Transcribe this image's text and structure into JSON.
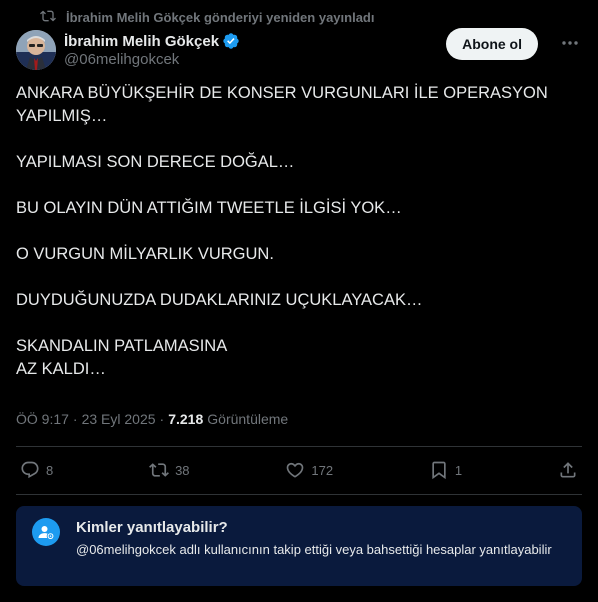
{
  "repost": {
    "icon": "repost-icon",
    "text": "İbrahim Melih Gökçek gönderiyi yeniden yayınladı"
  },
  "author": {
    "display_name": "İbrahim Melih Gökçek",
    "handle": "@06melihgokcek",
    "verified_icon": "verified-badge-icon",
    "verified_color": "#1d9bf0"
  },
  "header": {
    "follow_label": "Abone ol",
    "more_icon": "more-icon"
  },
  "tweet": {
    "paragraphs": [
      "ANKARA BÜYÜKŞEHİR DE KONSER VURGUNLARI İLE OPERASYON YAPILMIŞ…",
      "YAPILMASI SON DERECE DOĞAL…",
      "BU OLAYIN DÜN ATTIĞIM TWEETLE İLGİSİ YOK…",
      "O VURGUN MİLYARLIK VURGUN.",
      "DUYDUĞUNUZDA DUDAKLARINIZ UÇUKLAYACAK…",
      "SKANDALIN PATLAMASINA\nAZ KALDI…"
    ]
  },
  "meta": {
    "time": "ÖÖ 9:17",
    "separator": "·",
    "date": "23 Eyl 2025",
    "views_count": "7.218",
    "views_label": "Görüntüleme"
  },
  "actions": {
    "reply_count": "8",
    "repost_count": "38",
    "like_count": "172",
    "bookmark_count": "1"
  },
  "reply_restriction": {
    "icon": "mention-user-icon",
    "title": "Kimler yanıtlayabilir?",
    "description": "@06melihgokcek adlı kullanıcının takip ettiği veya bahsettiği hesaplar yanıtlayabilir"
  },
  "colors": {
    "background": "#000000",
    "text": "#e7e9ea",
    "muted": "#71767b",
    "accent": "#1d9bf0",
    "reply_box_bg": "#0a1a3d"
  }
}
